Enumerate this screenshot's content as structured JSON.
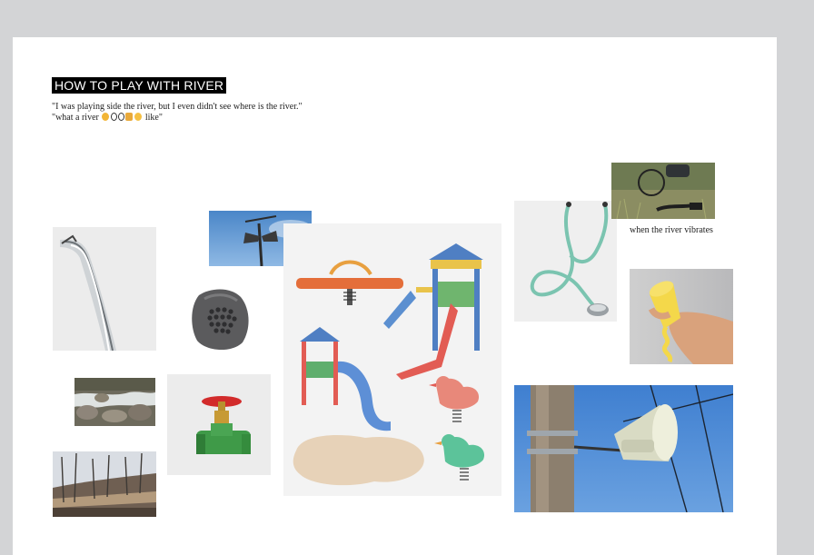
{
  "title": "HOW TO PLAY WITH RIVER",
  "quote_line1": "\"I was playing side the river, but I even didn't see where is the river.\"",
  "quote_line2_prefix": "\"what a river",
  "quote_line2_suffix": " like\"",
  "caption": "when the river vibrates",
  "colors": {
    "page_bg": "#ffffff",
    "canvas_bg": "#d3d4d6",
    "title_bg": "#000000",
    "title_fg": "#ffffff"
  },
  "images": [
    "water-stream-image",
    "rock-speaker-image",
    "river-rocks-image",
    "riverside-trees-image",
    "loudspeaker-pole-sky-image",
    "water-valve-image",
    "playground-illustration-image",
    "stethoscope-image",
    "grass-bicycle-image",
    "hand-cone-image",
    "megaphone-pole-image"
  ]
}
